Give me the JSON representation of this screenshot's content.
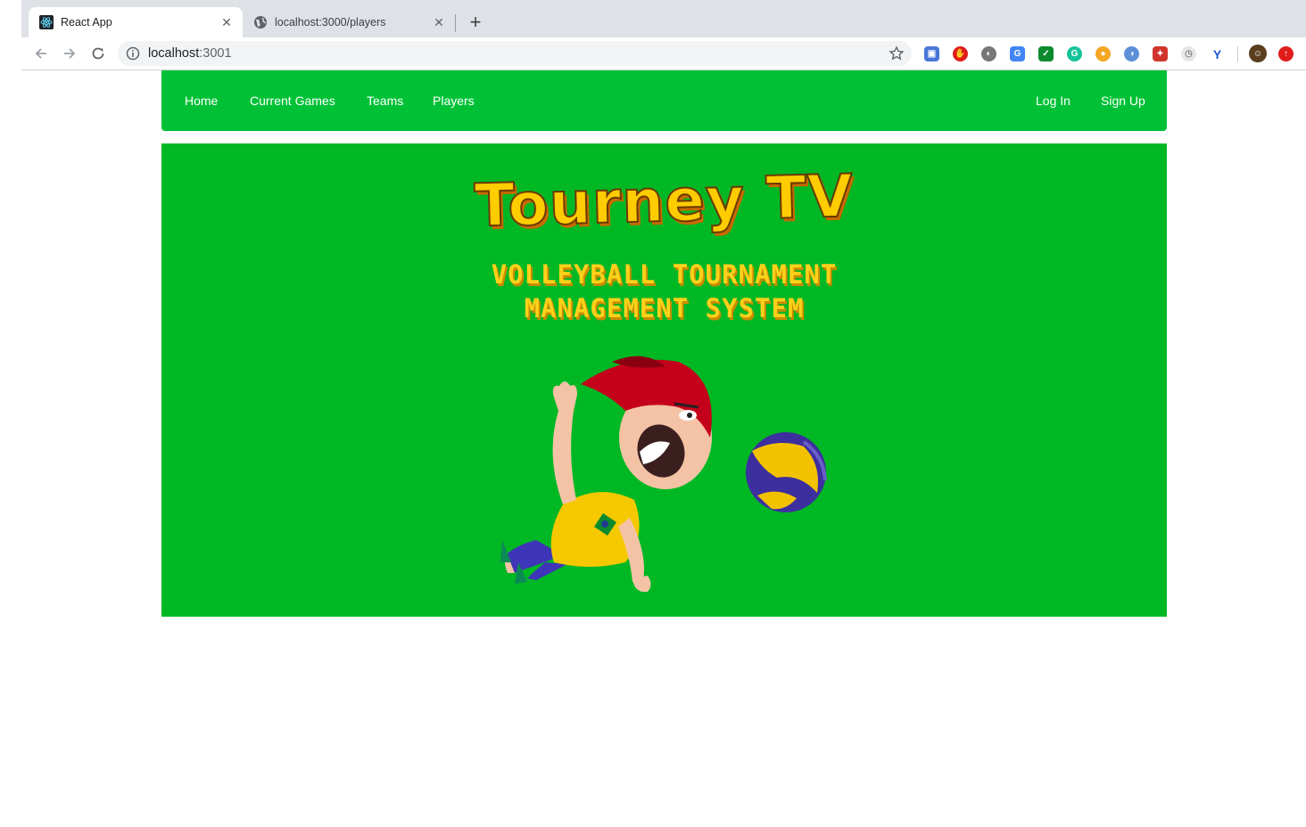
{
  "browser": {
    "tabs": [
      {
        "title": "React App",
        "favicon": "react-icon",
        "active": true
      },
      {
        "title": "localhost:3000/players",
        "favicon": "globe-icon",
        "active": false
      }
    ],
    "url": {
      "host": "localhost",
      "port": ":3001"
    },
    "extensions": [
      "camera-icon",
      "adblock-icon",
      "grayscale-icon",
      "translate-icon",
      "check-icon",
      "grammarly-icon",
      "cookie-icon",
      "proxy-icon",
      "puzzle-icon",
      "clock-icon",
      "vue-icon"
    ]
  },
  "navbar": {
    "links": [
      "Home",
      "Current Games",
      "Teams",
      "Players"
    ],
    "login": "Log In",
    "signup": "Sign Up"
  },
  "hero": {
    "title": "Tourney TV",
    "subtitle_line1": "VOLLEYBALL TOURNAMENT",
    "subtitle_line2": "MANAGEMENT SYSTEM",
    "illustration": "volleyball-player-illustration"
  },
  "colors": {
    "navbar": "#00c136",
    "hero": "#00b824",
    "title": "#ffcc00"
  }
}
